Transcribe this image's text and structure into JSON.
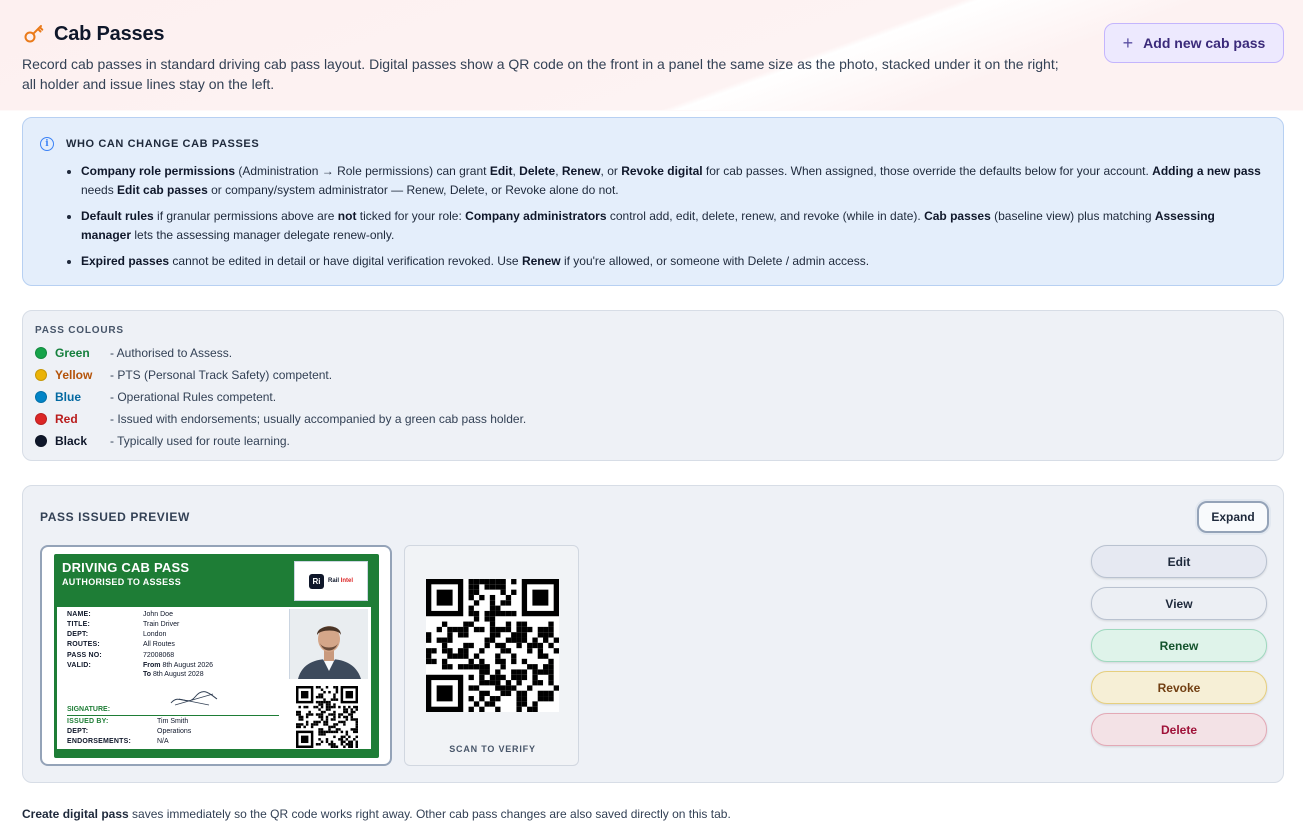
{
  "header": {
    "title": "Cab Passes",
    "subtitle": "Record cab passes in standard driving cab pass layout. Digital passes show a QR code on the front in a panel the same size as the photo, stacked under it on the right; all holder and issue lines stay on the left.",
    "add_button_label": "Add new cab pass",
    "icon": "key-icon"
  },
  "info": {
    "title": "WHO CAN CHANGE CAB PASSES",
    "items": [
      {
        "p1_bold": "Company role permissions",
        "p1": " (Administration → Role permissions) can grant ",
        "p2_bold": "Edit",
        "p2": ", ",
        "p3_bold": "Delete",
        "p3": ", ",
        "p4_bold": "Renew",
        "p4": ", or ",
        "p5_bold": "Revoke digital",
        "p5": " for cab passes. When assigned, those override the defaults below for your account. ",
        "p6_bold": "Adding a new pass",
        "p6": " needs ",
        "p7_bold": "Edit cab passes",
        "p7": " or company/system administrator — Renew, Delete, or Revoke alone do not."
      },
      {
        "p1_bold": "Default rules",
        "p1": " if granular permissions above are ",
        "p2_bold": "not",
        "p2": " ticked for your role: ",
        "p3_bold": "Company administrators",
        "p3": " control add, edit, delete, renew, and revoke (while in date). ",
        "p4_bold": "Cab passes",
        "p4": " (baseline view) plus matching ",
        "p5_bold": "Assessing manager",
        "p5": " lets the assessing manager delegate renew-only."
      },
      {
        "p1_bold": "Expired passes",
        "p1": " cannot be edited in detail or have digital verification revoked. Use ",
        "p2_bold": "Renew",
        "p2": " if you're allowed, or someone with Delete / admin access."
      }
    ]
  },
  "colours": {
    "title": "PASS COLOURS",
    "items": [
      {
        "name": "Green",
        "desc": "- Authorised to Assess.",
        "color": "#16a34a",
        "text_color": "#15803d"
      },
      {
        "name": "Yellow",
        "desc": "- PTS (Personal Track Safety) competent.",
        "color": "#eab308",
        "text_color": "#b45309"
      },
      {
        "name": "Blue",
        "desc": "- Operational Rules competent.",
        "color": "#0284c7",
        "text_color": "#0369a1"
      },
      {
        "name": "Red",
        "desc": "- Issued with endorsements; usually accompanied by a green cab pass holder.",
        "color": "#dc2626",
        "text_color": "#b91c1c"
      },
      {
        "name": "Black",
        "desc": "- Typically used for route learning.",
        "color": "#0f172a",
        "text_color": "#0f172a"
      }
    ]
  },
  "preview": {
    "title": "PASS ISSUED PREVIEW",
    "expand_label": "Expand",
    "card": {
      "title": "DRIVING CAB PASS",
      "subtitle": "AUTHORISED TO ASSESS",
      "logo_mark": "Ri",
      "logo_text_a": "Rail ",
      "logo_text_b": "Intel",
      "card_color": "#1e7d36",
      "fields": {
        "name_label": "NAME:",
        "name": "John Doe",
        "title_label": "TITLE:",
        "title": "Train Driver",
        "dept_label": "DEPT:",
        "dept": "London",
        "routes_label": "ROUTES:",
        "routes": "All Routes",
        "passno_label": "PASS NO:",
        "passno": "72008068",
        "valid_label": "VALID:",
        "valid_from_word": "From",
        "valid_from": " 8th August 2026",
        "valid_to_word": "To",
        "valid_to": " 8th August 2028",
        "signature_label": "SIGNATURE:",
        "issued_by_label": "ISSUED BY:",
        "issued_by": "Tim Smith",
        "dept2_label": "DEPT:",
        "dept2": "Operations",
        "endorsements_label": "ENDORSEMENTS:",
        "endorsements": "N/A"
      }
    },
    "scan_label": "SCAN TO VERIFY",
    "actions": {
      "edit": "Edit",
      "view": "View",
      "renew": "Renew",
      "revoke": "Revoke",
      "delete": "Delete"
    }
  },
  "footer": {
    "bold": "Create digital pass",
    "text": " saves immediately so the QR code works right away. Other cab pass changes are also saved directly on this tab."
  }
}
